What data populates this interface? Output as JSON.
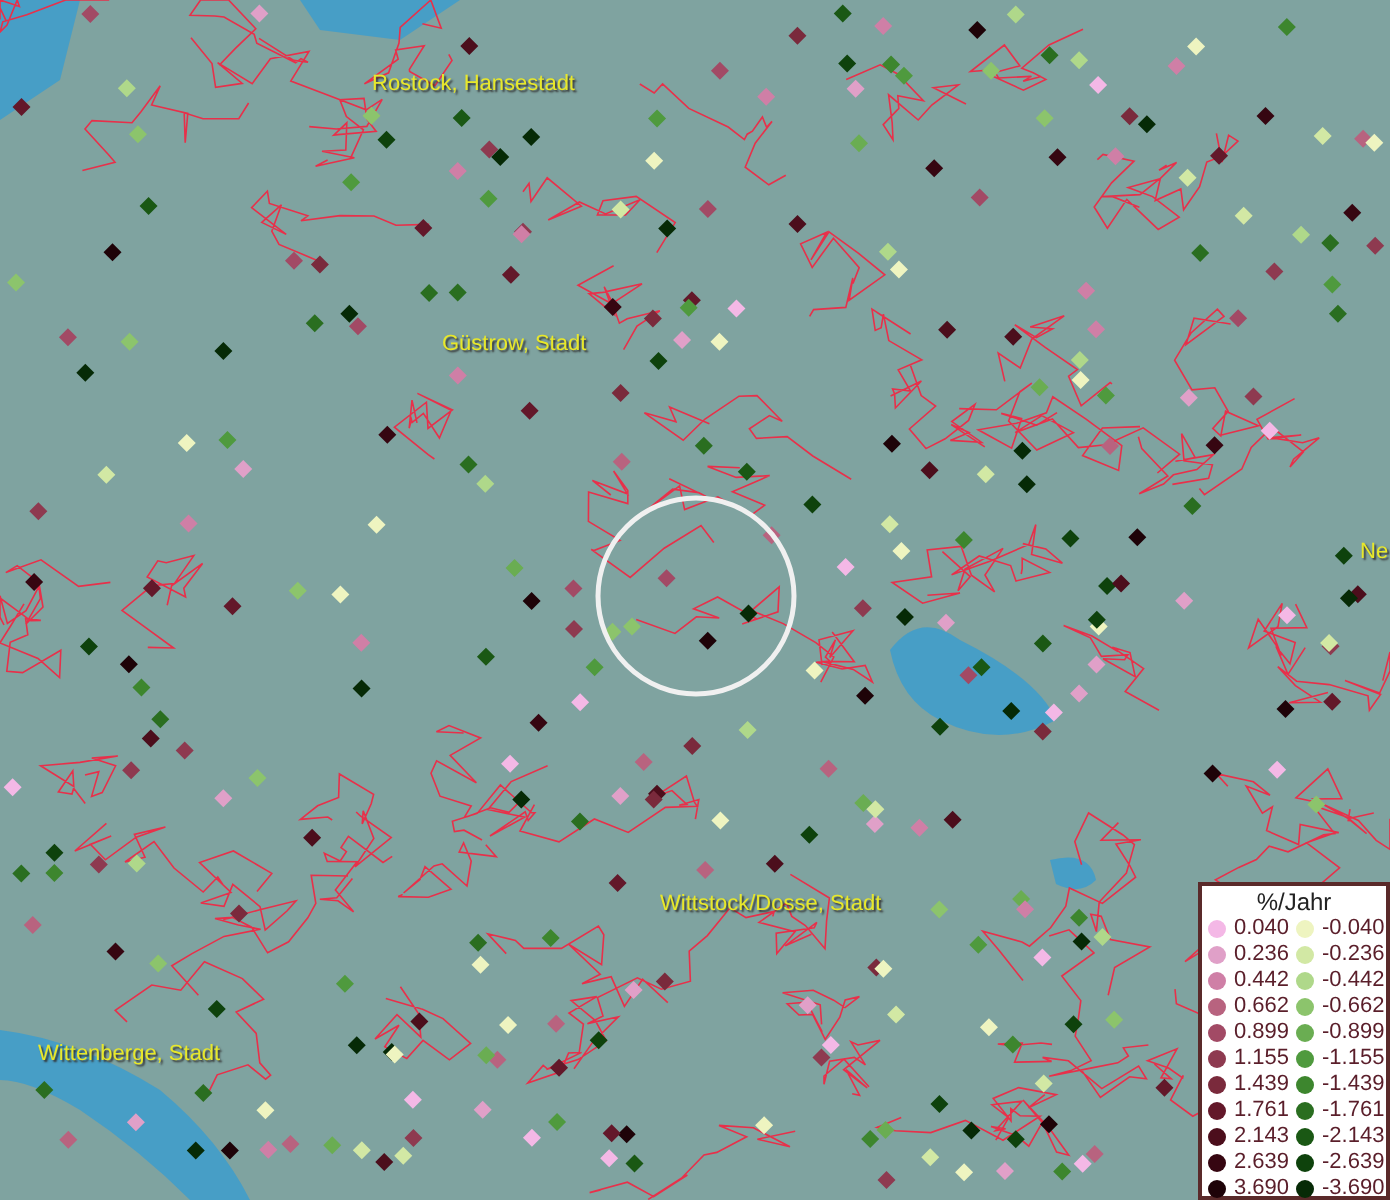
{
  "map_labels": [
    {
      "text": "Rostock, Hansestadt"
    },
    {
      "text": "Güstrow, Stadt"
    },
    {
      "text": "Wittstock/Dosse, Stadt"
    },
    {
      "text": "Wittenberge, Stadt"
    },
    {
      "text": "Ne"
    }
  ],
  "legend": {
    "title": "%/Jahr",
    "positive": [
      {
        "label": "0.040",
        "color": "#f4b8e6"
      },
      {
        "label": "0.236",
        "color": "#e0a0c8"
      },
      {
        "label": "0.442",
        "color": "#cf7fa6"
      },
      {
        "label": "0.662",
        "color": "#b8637f"
      },
      {
        "label": "0.899",
        "color": "#a24a65"
      },
      {
        "label": "1.155",
        "color": "#8e3a50"
      },
      {
        "label": "1.439",
        "color": "#7a2a3c"
      },
      {
        "label": "1.761",
        "color": "#63182a"
      },
      {
        "label": "2.143",
        "color": "#4c0e1c"
      },
      {
        "label": "2.639",
        "color": "#360611"
      },
      {
        "label": "3.690",
        "color": "#1e0308"
      }
    ],
    "negative": [
      {
        "label": "-0.040",
        "color": "#eef4c0"
      },
      {
        "label": "-0.236",
        "color": "#d2e8a4"
      },
      {
        "label": "-0.442",
        "color": "#afd88a"
      },
      {
        "label": "-0.662",
        "color": "#8cc46c"
      },
      {
        "label": "-0.899",
        "color": "#6aad52"
      },
      {
        "label": "-1.155",
        "color": "#4f9a3e"
      },
      {
        "label": "-1.439",
        "color": "#3d862e"
      },
      {
        "label": "-1.761",
        "color": "#2a6e20"
      },
      {
        "label": "-2.143",
        "color": "#1a5814"
      },
      {
        "label": "-2.639",
        "color": "#0e420c"
      },
      {
        "label": "-3.690",
        "color": "#062a06"
      }
    ]
  }
}
